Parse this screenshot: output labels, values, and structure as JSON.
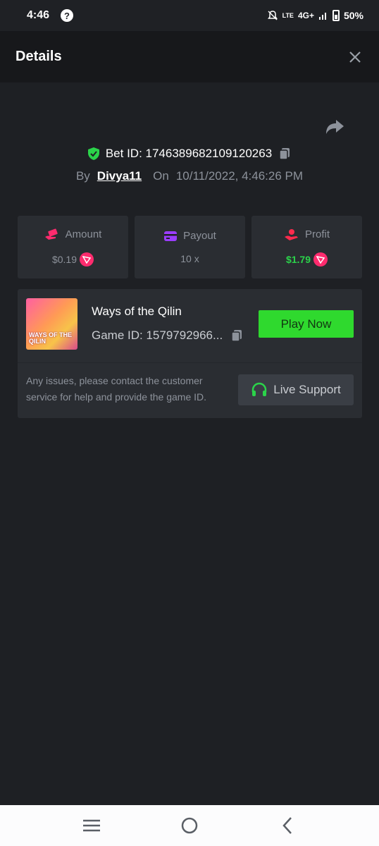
{
  "status_bar": {
    "time": "4:46",
    "network": "4G+",
    "lte": "LTE",
    "battery": "50%"
  },
  "header": {
    "title": "Details"
  },
  "bet": {
    "bet_id_label": "Bet ID: 1746389682109120263",
    "by_label": "By",
    "username": "Divya11",
    "on_label": "On",
    "datetime": "10/11/2022, 4:46:26 PM"
  },
  "stats": {
    "amount_label": "Amount",
    "amount_value": "$0.19",
    "payout_label": "Payout",
    "payout_value": "10 x",
    "profit_label": "Profit",
    "profit_value": "$1.79"
  },
  "game": {
    "thumb_text": "WAYS OF THE QILIN",
    "name": "Ways of the Qilin",
    "id_label": "Game ID: 1579792966...",
    "play_label": "Play Now",
    "issue_text": "Any issues, please contact the customer service for help and provide the game ID.",
    "support_label": "Live Support"
  },
  "colors": {
    "accent_green": "#2fd92e",
    "profit_green": "#2bd34a",
    "coin_pink": "#ff2b6e",
    "payout_purple": "#9b3dff"
  }
}
